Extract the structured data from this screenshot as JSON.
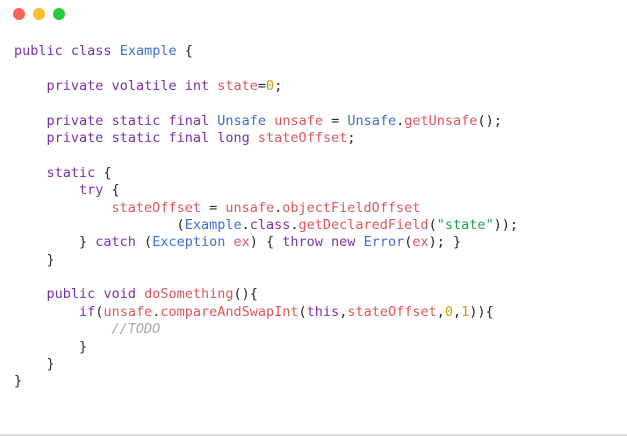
{
  "window": {
    "buttons": [
      {
        "name": "close",
        "color": "#ff5f56"
      },
      {
        "name": "minimize",
        "color": "#ffbd2e"
      },
      {
        "name": "maximize",
        "color": "#27c93f"
      }
    ]
  },
  "code": {
    "lines": [
      "public class Example {",
      "",
      "    private volatile int state=0;",
      "",
      "    private static final Unsafe unsafe = Unsafe.getUnsafe();",
      "    private static final long stateOffset;",
      "",
      "    static {",
      "        try {",
      "            stateOffset = unsafe.objectFieldOffset",
      "                    (Example.class.getDeclaredField(\"state\"));",
      "        } catch (Exception ex) { throw new Error(ex); }",
      "    }",
      "",
      "    public void doSomething(){",
      "        if(unsafe.compareAndSwapInt(this,stateOffset,0,1)){",
      "            //TODO",
      "        }",
      "    }",
      "}"
    ]
  }
}
